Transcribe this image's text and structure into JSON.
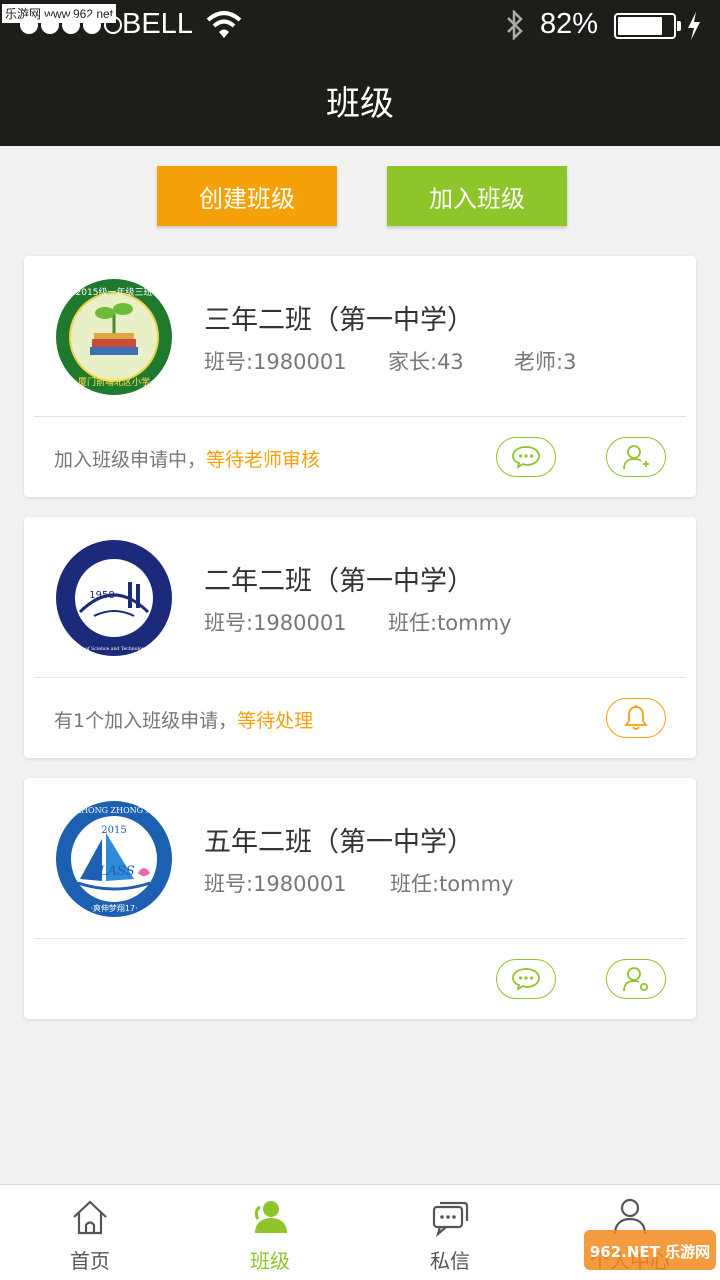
{
  "status_bar": {
    "watermark": "乐游网 www.962.net",
    "carrier": "BELL",
    "battery_percent": "82%",
    "battery_level": 0.82,
    "icons": [
      "signal-dots-icon",
      "wifi-icon",
      "bluetooth-icon",
      "battery-icon",
      "charging-bolt-icon"
    ]
  },
  "header": {
    "title": "班级"
  },
  "actions": {
    "create_label": "创建班级",
    "join_label": "加入班级"
  },
  "colors": {
    "orange": "#f5a20a",
    "green": "#8ec52b",
    "header_bg": "#1d1e1a"
  },
  "cards": [
    {
      "name": "三年二班（第一中学）",
      "class_no": "班号:1980001",
      "parents": "家长:43",
      "teachers": "老师:3",
      "status_prefix": "加入班级申请中，",
      "status_highlight": "等待老师审核",
      "logo": {
        "top_text": "2015级一年级三班",
        "bottom_text": "厦门前埔北区小学"
      },
      "buttons": [
        "chat-bubble-icon",
        "add-user-icon"
      ]
    },
    {
      "name": "二年二班（第一中学）",
      "class_no": "班号:1980001",
      "head_teacher": "班任:tommy",
      "status_prefix": "有1个加入班级申请，",
      "status_highlight": "等待处理",
      "logo": {
        "year": "1958",
        "ring_text": "University of Science and Technology of China"
      },
      "buttons": [
        "bell-icon"
      ]
    },
    {
      "name": "五年二班（第一中学）",
      "class_no": "班号:1980001",
      "head_teacher": "班任:tommy",
      "logo": {
        "ring_text": "XI ZHONG ZHONG XUE",
        "year": "2015",
        "word": "CLASS",
        "bottom_text": "·爽伸梦翔17·"
      },
      "buttons": [
        "chat-bubble-icon",
        "user-search-icon"
      ]
    }
  ],
  "tabbar": {
    "tabs": [
      {
        "label": "首页",
        "icon": "home-icon",
        "active": false
      },
      {
        "label": "班级",
        "icon": "class-people-icon",
        "active": true
      },
      {
        "label": "私信",
        "icon": "messages-icon",
        "active": false
      },
      {
        "label": "个人中心",
        "icon": "person-icon",
        "active": false
      }
    ]
  },
  "corner_watermark": "962.NET 乐游网"
}
